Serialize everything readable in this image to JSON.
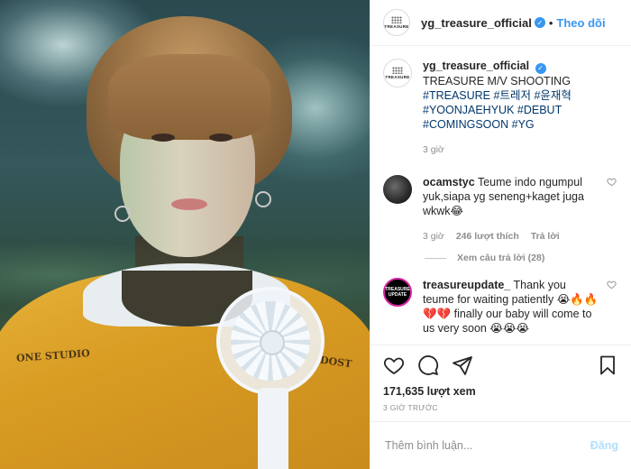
{
  "post": {
    "username": "yg_treasure_official",
    "verified": true,
    "follow_label": "Theo dõi",
    "avatar_text": "TREASURE"
  },
  "caption": {
    "username": "yg_treasure_official",
    "line1": "TREASURE M/V",
    "line2": "SHOOTING",
    "hashtags": [
      "#TREASURE",
      "#트레저",
      "#윤재혁",
      "#YOONJAEHYUK",
      "#DEBUT",
      "#COMINGSOON",
      "#YG"
    ],
    "time": "3 giờ"
  },
  "comments": [
    {
      "username": "ocamstyc",
      "text": "Teume indo ngumpul yuk,siapa yg seneng+kaget juga wkwk😂",
      "time": "3 giờ",
      "likes": "246 lượt thích",
      "reply_label": "Trả lời",
      "view_replies": "Xem câu trả lời (28)"
    },
    {
      "username": "treasureupdate_",
      "text": "Thank you teume for waiting patiently 😭🔥🔥💔💔 finally our baby will come to us very soon 😭😭😭",
      "avatar_text": "TREASURE UPDATE"
    }
  ],
  "stats": {
    "views": "171,635 lượt xem",
    "date": "3 GIỜ TRƯỚC"
  },
  "add_comment": {
    "placeholder": "Thêm bình luận...",
    "post_label": "Đăng"
  },
  "media": {
    "shirt_print_left": "ONE STUDIO",
    "shirt_print_right": "DOST"
  },
  "colors": {
    "accent": "#3897f0",
    "hashtag": "#00376b",
    "muted": "#8e8e8e",
    "post_disabled": "#b2dffc"
  },
  "icons": [
    "heart-icon",
    "comment-icon",
    "share-icon",
    "bookmark-icon",
    "verified-badge-icon"
  ]
}
